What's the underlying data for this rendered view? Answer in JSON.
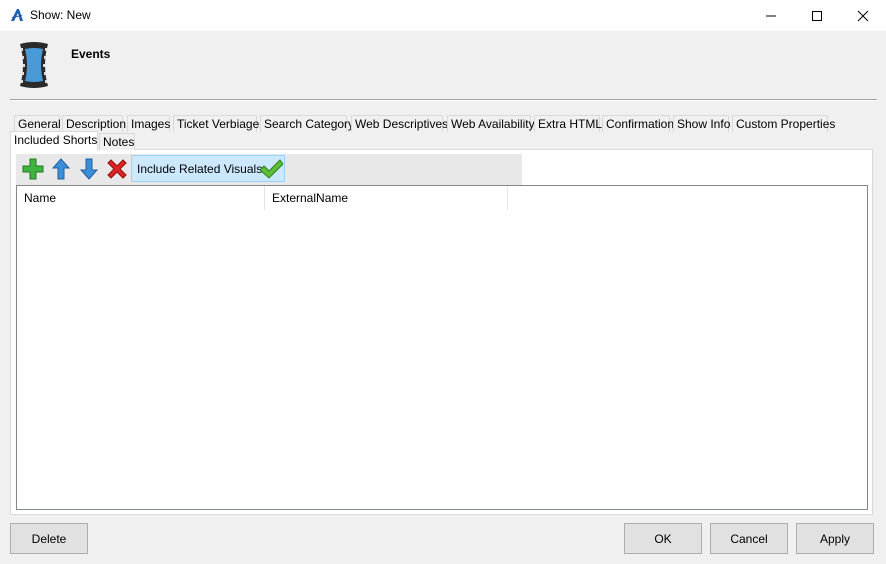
{
  "window": {
    "title": "Show: New",
    "app_icon": "app-logo-icon",
    "controls": {
      "minimize": "minimize-icon",
      "maximize": "maximize-icon",
      "close": "close-icon"
    }
  },
  "header": {
    "title": "Events",
    "icon": "film-strip-icon"
  },
  "tabs": {
    "row1": [
      "General",
      "Description",
      "Images",
      "Ticket Verbiage",
      "Search Category",
      "Web Descriptives",
      "Web Availability",
      "Extra HTML",
      "Confirmation",
      "Show Info",
      "Custom Properties"
    ],
    "row2": [
      "Included Shorts",
      "Notes"
    ],
    "active": "Included Shorts"
  },
  "toolbar": {
    "add_icon": "plus-icon",
    "up_icon": "arrow-up-icon",
    "down_icon": "arrow-down-icon",
    "delete_icon": "red-x-icon",
    "toggle_label": "Include Related Visuals",
    "toggle_icon": "checkmark-icon",
    "toggle_checked": true
  },
  "list": {
    "columns": [
      "Name",
      "ExternalName"
    ],
    "rows": []
  },
  "buttons": {
    "delete": "Delete",
    "ok": "OK",
    "cancel": "Cancel",
    "apply": "Apply"
  },
  "colors": {
    "toggle_bg": "#cce8ff",
    "toggle_border": "#99d1ff",
    "window_bg": "#f0f0f0"
  }
}
